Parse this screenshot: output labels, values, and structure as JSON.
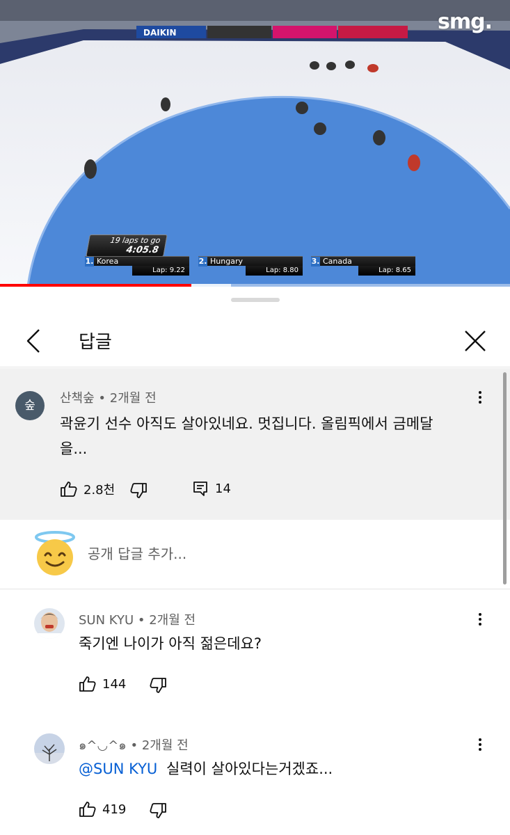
{
  "video": {
    "watermark": "smg.",
    "laps_to_go": "19 laps to go",
    "time": "4:05.8",
    "standings": [
      {
        "rank": "1.",
        "team": "Korea",
        "lap": "Lap: 9.22"
      },
      {
        "rank": "2.",
        "team": "Hungary",
        "lap": "Lap: 8.80"
      },
      {
        "rank": "3.",
        "team": "Canada",
        "lap": "Lap: 8.65"
      }
    ],
    "boards": [
      "DAIKIN"
    ],
    "progress_played": 0.375,
    "progress_buffered": 0.453
  },
  "sheet": {
    "title": "답글",
    "back_icon": "chevron-left-icon",
    "close_icon": "close-icon"
  },
  "parent_comment": {
    "avatar_letter": "숲",
    "author": "산책숲",
    "separator": "•",
    "time": "2개월 전",
    "text_line1": "곽윤기 선수 아직도 살아있네요. 멋집니다.  올림픽에서 금메달",
    "text_line2": "을...",
    "likes": "2.8천",
    "replies": "14"
  },
  "add_reply": {
    "placeholder": "공개 답글 추가..."
  },
  "replies": [
    {
      "author": "SUN KYU",
      "separator": "•",
      "time": "2개월 전",
      "text": "죽기엔 나이가 아직 젊은데요?",
      "likes": "144"
    },
    {
      "author": "๑^◡^๑",
      "separator": "•",
      "time": "2개월 전",
      "mention": "@SUN KYU",
      "text": "실력이 살아있다는거겠죠...",
      "likes": "419"
    }
  ],
  "colors": {
    "progress_red": "#ff0000",
    "mention_blue": "#065fd4",
    "parent_bg": "#f1f1f1",
    "rink_blue": "#4d88d8"
  }
}
